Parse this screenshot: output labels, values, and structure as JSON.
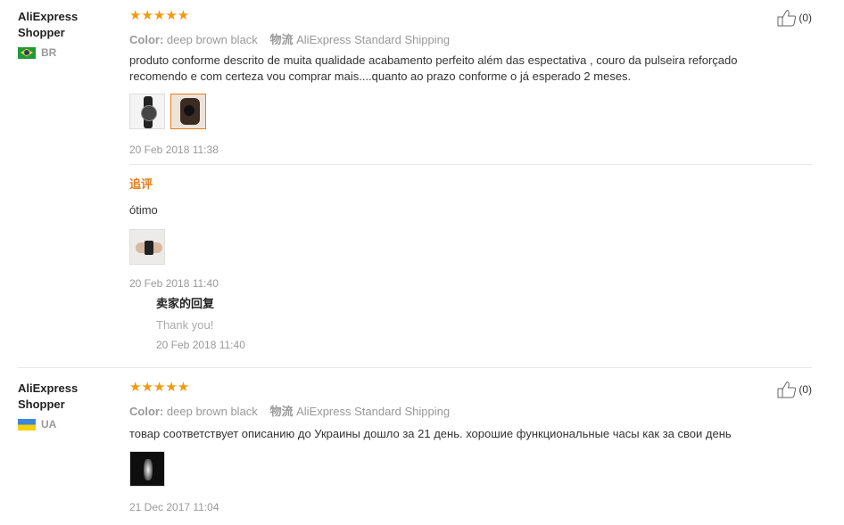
{
  "reviews": [
    {
      "user": "AliExpress Shopper",
      "country": "BR",
      "stars": "★★★★★",
      "color_label": "Color:",
      "color_value": "deep brown black",
      "ship_label": "物流",
      "ship_value": "AliExpress Standard Shipping",
      "text": "produto conforme descrito de muita qualidade acabamento perfeito além das espectativa , couro da pulseira reforçado recomendo e com certeza vou comprar mais....quanto ao prazo conforme o já esperado 2 meses.",
      "date": "20 Feb 2018 11:38",
      "helpful_count": "(0)",
      "additional_label": "追评",
      "additional_text": "ótimo",
      "additional_date": "20 Feb 2018 11:40",
      "seller_reply_label": "卖家的回复",
      "seller_reply_text": "Thank you!",
      "seller_reply_date": "20 Feb 2018 11:40"
    },
    {
      "user": "AliExpress Shopper",
      "country": "UA",
      "stars": "★★★★★",
      "color_label": "Color:",
      "color_value": "deep brown black",
      "ship_label": "物流",
      "ship_value": "AliExpress Standard Shipping",
      "text": "товар соответствует описанию до Украины дошло за 21 день. хорошие функциональные часы как за свои день",
      "date": "21 Dec 2017 11:04",
      "helpful_count": "(0)"
    }
  ],
  "colors": {
    "accent": "#f09b0c",
    "muted": "#999999",
    "highlight": "#e37f1b"
  }
}
